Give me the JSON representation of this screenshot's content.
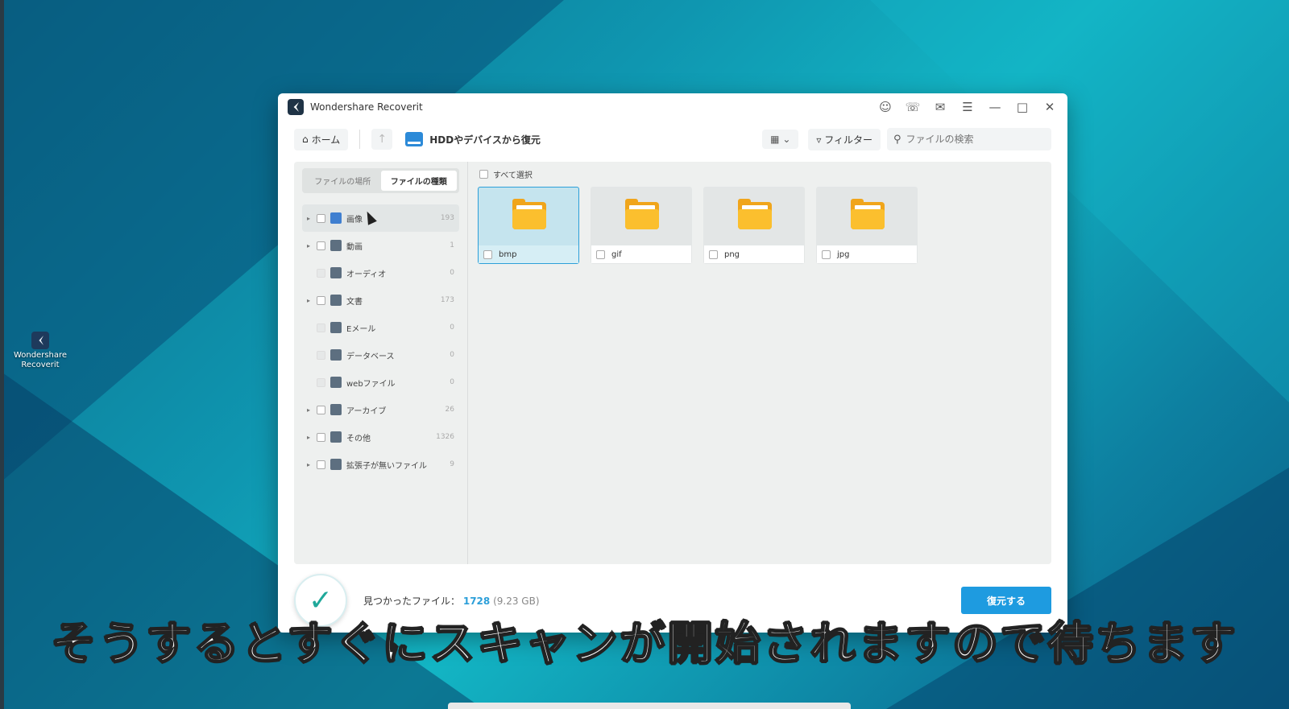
{
  "desktop": {
    "icon_label": "Wondershare Recoverit"
  },
  "window": {
    "title": "Wondershare Recoverit",
    "toolbar": {
      "home_label": "ホーム",
      "source_label": "HDDやデバイスから復元",
      "filter_label": "フィルター",
      "search_placeholder": "ファイルの検索"
    },
    "sidebar": {
      "tabs": [
        {
          "label": "ファイルの場所",
          "active": false
        },
        {
          "label": "ファイルの種類",
          "active": true
        }
      ],
      "categories": [
        {
          "label": "画像",
          "count": "193",
          "expandable": true,
          "icon": "image-icon"
        },
        {
          "label": "動画",
          "count": "1",
          "expandable": true,
          "icon": "video-icon"
        },
        {
          "label": "オーディオ",
          "count": "0",
          "expandable": false,
          "icon": "audio-icon"
        },
        {
          "label": "文書",
          "count": "173",
          "expandable": true,
          "icon": "document-icon"
        },
        {
          "label": "Eメール",
          "count": "0",
          "expandable": false,
          "icon": "email-icon"
        },
        {
          "label": "データベース",
          "count": "0",
          "expandable": false,
          "icon": "database-icon"
        },
        {
          "label": "webファイル",
          "count": "0",
          "expandable": false,
          "icon": "web-file-icon"
        },
        {
          "label": "アーカイブ",
          "count": "26",
          "expandable": true,
          "icon": "archive-icon"
        },
        {
          "label": "その他",
          "count": "1326",
          "expandable": true,
          "icon": "other-icon"
        },
        {
          "label": "拡張子が無いファイル",
          "count": "9",
          "expandable": true,
          "icon": "no-extension-icon"
        }
      ]
    },
    "main": {
      "select_all_label": "すべて選択",
      "folders": [
        {
          "name": "bmp",
          "selected": true
        },
        {
          "name": "gif",
          "selected": false
        },
        {
          "name": "png",
          "selected": false
        },
        {
          "name": "jpg",
          "selected": false
        }
      ]
    },
    "footer": {
      "found_label": "見つかったファイル：",
      "found_count": "1728",
      "found_size": "(9.23 GB)",
      "recover_label": "復元する"
    }
  },
  "subtitle": "そうするとすぐにスキャンが開始されますので待ちます",
  "colors": {
    "accent": "#1e9be0",
    "folder": "#f0a51b",
    "check": "#1fa89a"
  }
}
